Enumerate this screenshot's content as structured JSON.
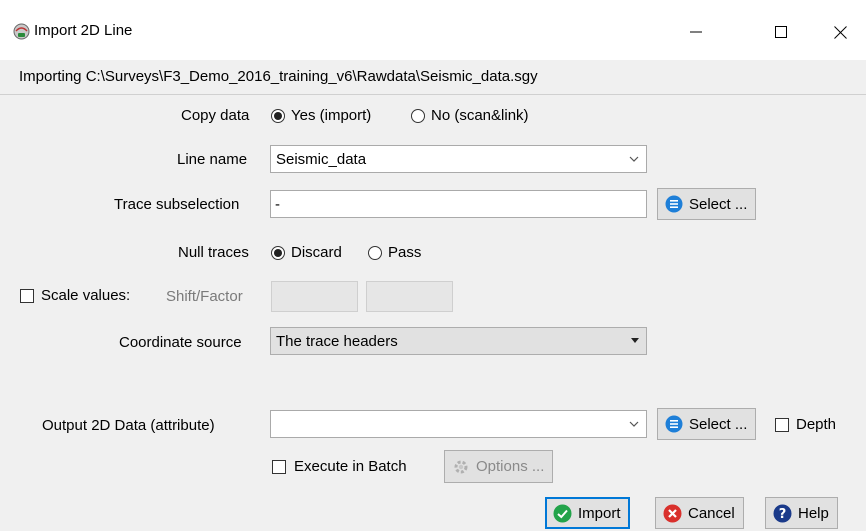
{
  "window": {
    "title": "Import 2D Line",
    "minimize_icon": "minimize-icon",
    "maximize_icon": "maximize-icon",
    "close_icon": "close-icon"
  },
  "path_text": "Importing C:\\Surveys\\F3_Demo_2016_training_v6\\Rawdata\\Seismic_data.sgy",
  "copy_data": {
    "label": "Copy data",
    "options": [
      "Yes (import)",
      "No (scan&link)"
    ],
    "selected": "Yes (import)"
  },
  "line_name": {
    "label": "Line name",
    "value": "Seismic_data"
  },
  "trace_subselection": {
    "label": "Trace subselection",
    "value": "-",
    "button": "Select ..."
  },
  "null_traces": {
    "label": "Null traces",
    "options": [
      "Discard",
      "Pass"
    ],
    "selected": "Discard"
  },
  "scale_values": {
    "label": "Scale values:",
    "sub_label": "Shift/Factor",
    "checked": false
  },
  "coordinate_source": {
    "label": "Coordinate source",
    "value": "The trace headers"
  },
  "output": {
    "label": "Output 2D Data (attribute)",
    "value": "",
    "button": "Select ...",
    "depth_label": "Depth",
    "depth_checked": false
  },
  "batch": {
    "label": "Execute in Batch",
    "checked": false,
    "options_button": "Options ..."
  },
  "footer": {
    "import_label": "Import",
    "cancel_label": "Cancel",
    "help_label": "Help"
  },
  "colors": {
    "accent_blue": "#0078d7",
    "select_icon_blue": "#1e7fd8",
    "import_green": "#22a34a",
    "cancel_red": "#d9302c",
    "help_navy": "#1a3a8a"
  }
}
